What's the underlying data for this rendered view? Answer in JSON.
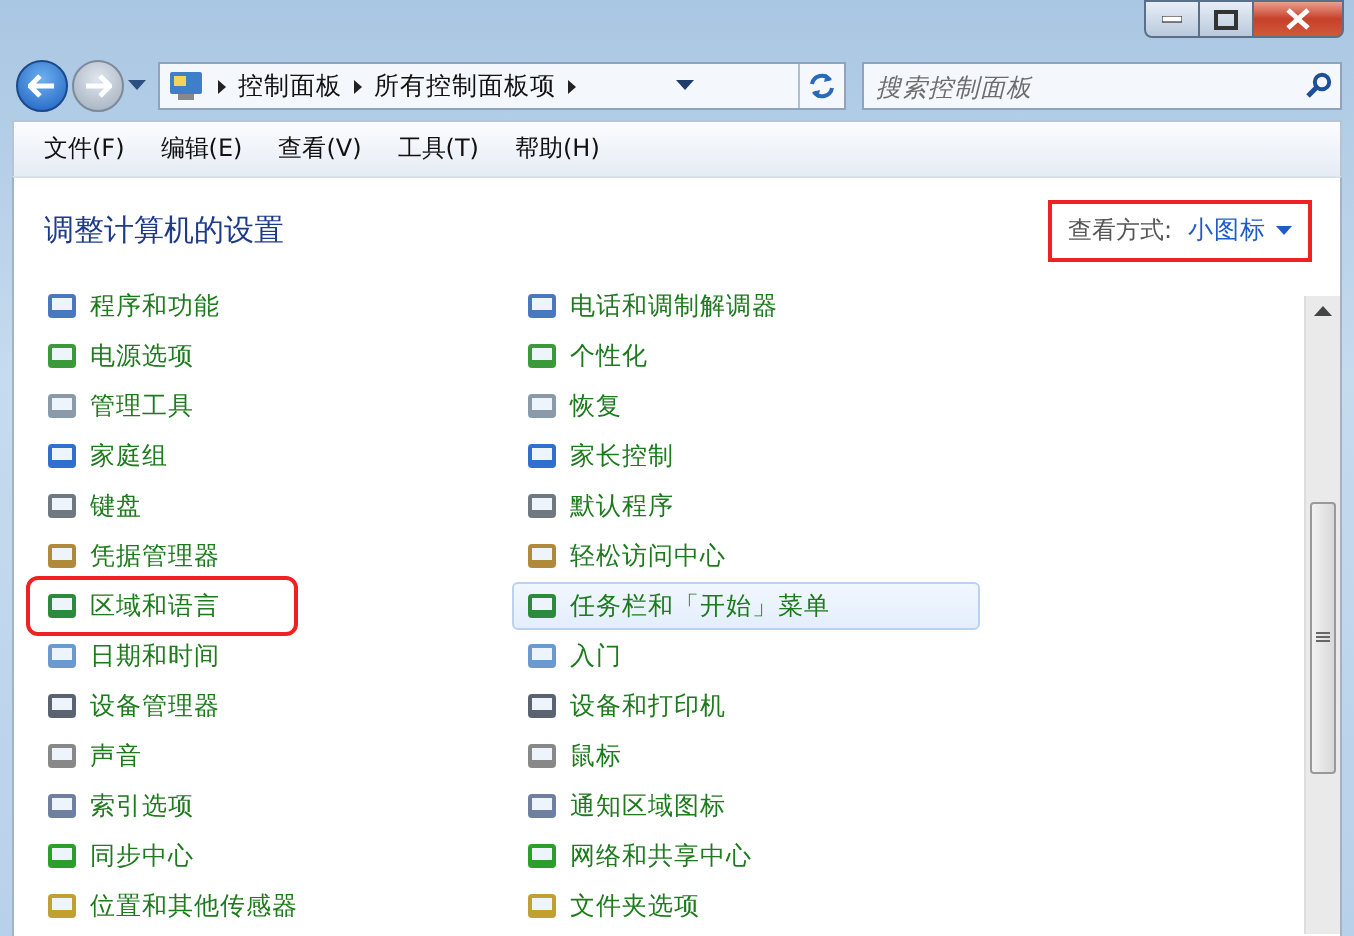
{
  "window": {
    "search": {
      "placeholder": "搜索控制面板"
    },
    "breadcrumb": [
      {
        "label": "控制面板"
      },
      {
        "label": "所有控制面板项"
      }
    ]
  },
  "menu_bar": [
    {
      "label": "文件(F)"
    },
    {
      "label": "编辑(E)"
    },
    {
      "label": "查看(V)"
    },
    {
      "label": "工具(T)"
    },
    {
      "label": "帮助(H)"
    }
  ],
  "header": {
    "title": "调整计算机的设置",
    "view_by": {
      "label": "查看方式:",
      "value": "小图标",
      "highlighted": true
    }
  },
  "left_items": [
    {
      "label": "程序和功能",
      "hovered": false,
      "highlighted": false
    },
    {
      "label": "电源选项",
      "hovered": false,
      "highlighted": false
    },
    {
      "label": "管理工具",
      "hovered": false,
      "highlighted": false
    },
    {
      "label": "家庭组",
      "hovered": false,
      "highlighted": false
    },
    {
      "label": "键盘",
      "hovered": false,
      "highlighted": false
    },
    {
      "label": "凭据管理器",
      "hovered": false,
      "highlighted": false
    },
    {
      "label": "区域和语言",
      "hovered": false,
      "highlighted": true
    },
    {
      "label": "日期和时间",
      "hovered": false,
      "highlighted": false
    },
    {
      "label": "设备管理器",
      "hovered": false,
      "highlighted": false
    },
    {
      "label": "声音",
      "hovered": false,
      "highlighted": false
    },
    {
      "label": "索引选项",
      "hovered": false,
      "highlighted": false
    },
    {
      "label": "同步中心",
      "hovered": false,
      "highlighted": false
    },
    {
      "label": "位置和其他传感器",
      "hovered": false,
      "highlighted": false
    }
  ],
  "right_items": [
    {
      "label": "电话和调制解调器",
      "hovered": false,
      "highlighted": false
    },
    {
      "label": "个性化",
      "hovered": false,
      "highlighted": false
    },
    {
      "label": "恢复",
      "hovered": false,
      "highlighted": false
    },
    {
      "label": "家长控制",
      "hovered": false,
      "highlighted": false
    },
    {
      "label": "默认程序",
      "hovered": false,
      "highlighted": false
    },
    {
      "label": "轻松访问中心",
      "hovered": false,
      "highlighted": false
    },
    {
      "label": "任务栏和「开始」菜单",
      "hovered": true,
      "highlighted": false
    },
    {
      "label": "入门",
      "hovered": false,
      "highlighted": false
    },
    {
      "label": "设备和打印机",
      "hovered": false,
      "highlighted": false
    },
    {
      "label": "鼠标",
      "hovered": false,
      "highlighted": false
    },
    {
      "label": "通知区域图标",
      "hovered": false,
      "highlighted": false
    },
    {
      "label": "网络和共享中心",
      "hovered": false,
      "highlighted": false
    },
    {
      "label": "文件夹选项",
      "hovered": false,
      "highlighted": false
    }
  ]
}
